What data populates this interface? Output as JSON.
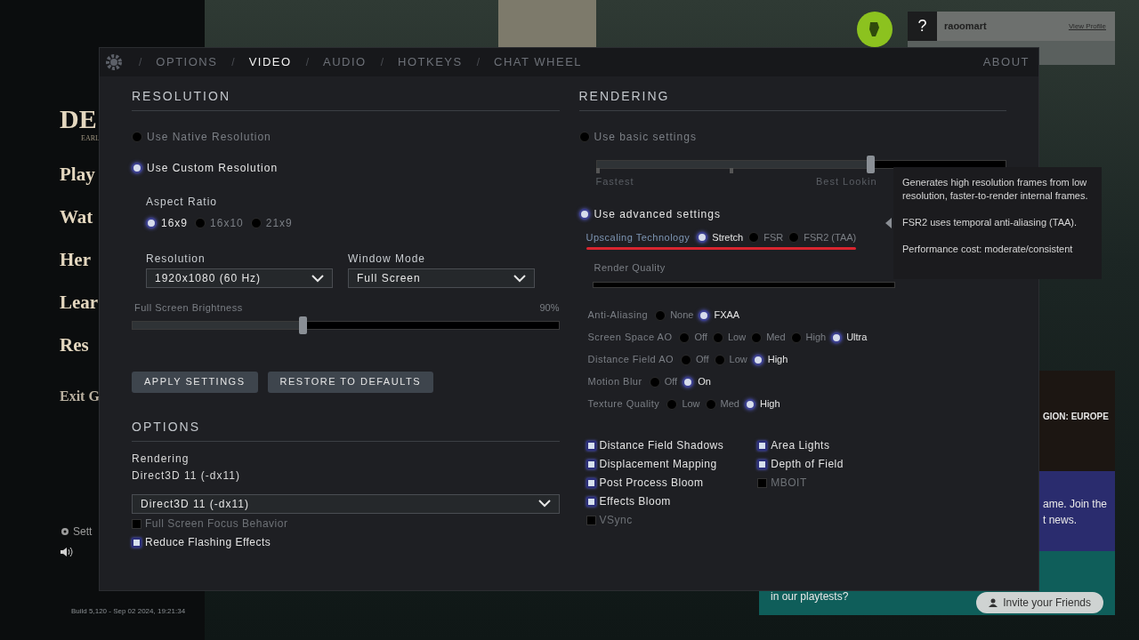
{
  "background": {
    "logo": "DE",
    "logo_sub": "EARL",
    "menu": [
      "Play",
      "Wat",
      "Her",
      "Lear",
      "Res"
    ],
    "exit": "Exit G",
    "settings": "Sett",
    "build": "Build 5,120 - Sep 02 2024, 19:21:34",
    "profile": {
      "badge": "?",
      "name": "raoomart",
      "link": "View Profile"
    },
    "region": "GION: EUROPE",
    "promo_lines": [
      "ame. Join the",
      "t news."
    ],
    "playtest": "in our playtests?",
    "invite": "Invite your Friends"
  },
  "header": {
    "separator": "/",
    "tabs": [
      {
        "label": "OPTIONS",
        "selected": false
      },
      {
        "label": "VIDEO",
        "selected": true
      },
      {
        "label": "AUDIO",
        "selected": false
      },
      {
        "label": "HOTKEYS",
        "selected": false
      },
      {
        "label": "CHAT WHEEL",
        "selected": false
      }
    ],
    "about": "ABOUT"
  },
  "resolution": {
    "title": "RESOLUTION",
    "modes": [
      {
        "label": "Use Native Resolution",
        "selected": false
      },
      {
        "label": "Use Custom Resolution",
        "selected": true
      }
    ],
    "aspect_label": "Aspect Ratio",
    "aspects": [
      {
        "label": "16x9",
        "selected": true
      },
      {
        "label": "16x10",
        "selected": false
      },
      {
        "label": "21x9",
        "selected": false
      }
    ],
    "resolution_label": "Resolution",
    "resolution_value": "1920x1080 (60 Hz)",
    "window_label": "Window Mode",
    "window_value": "Full Screen",
    "brightness_label": "Full Screen Brightness",
    "brightness_reading": "90%",
    "brightness": {
      "level": 0.4
    }
  },
  "buttons": [
    "APPLY SETTINGS",
    "RESTORE TO DEFAULTS"
  ],
  "options": {
    "title": "OPTIONS",
    "rendering_label": "Rendering",
    "rendering_value": "Direct3D 11 (-dx11)",
    "dropdown_value": "Direct3D 11 (-dx11)",
    "checks": [
      {
        "label": "Full Screen Focus Behavior",
        "checked": false
      },
      {
        "label": "Reduce Flashing Effects",
        "checked": true
      }
    ]
  },
  "rendering": {
    "title": "RENDERING",
    "basic": {
      "label": "Use basic settings",
      "selected": false
    },
    "basic_slider": {
      "level": 0.67
    },
    "fastest": "Fastest",
    "best": "Best Lookin",
    "advanced": {
      "label": "Use advanced settings",
      "selected": true
    },
    "upscaling": {
      "label": "Upscaling Technology",
      "underlined": true,
      "options": [
        {
          "label": "Stretch",
          "selected": true
        },
        {
          "label": "FSR",
          "selected": false
        },
        {
          "label": "FSR2 (TAA)",
          "selected": false
        }
      ]
    },
    "render_quality": "Render Quality",
    "groups": [
      {
        "label": "Anti-Aliasing",
        "options": [
          {
            "label": "None",
            "selected": false
          },
          {
            "label": "FXAA",
            "selected": true
          }
        ]
      },
      {
        "label": "Screen Space AO",
        "options": [
          {
            "label": "Off",
            "selected": false
          },
          {
            "label": "Low",
            "selected": false
          },
          {
            "label": "Med",
            "selected": false
          },
          {
            "label": "High",
            "selected": false
          },
          {
            "label": "Ultra",
            "selected": true
          }
        ]
      },
      {
        "label": "Distance Field AO",
        "options": [
          {
            "label": "Off",
            "selected": false
          },
          {
            "label": "Low",
            "selected": false
          },
          {
            "label": "High",
            "selected": true
          }
        ]
      },
      {
        "label": "Motion Blur",
        "options": [
          {
            "label": "Off",
            "selected": false
          },
          {
            "label": "On",
            "selected": true
          }
        ]
      },
      {
        "label": "Texture Quality",
        "options": [
          {
            "label": "Low",
            "selected": false
          },
          {
            "label": "Med",
            "selected": false
          },
          {
            "label": "High",
            "selected": true
          }
        ]
      }
    ],
    "checks_left": [
      {
        "label": "Distance Field Shadows",
        "checked": true
      },
      {
        "label": "Displacement Mapping",
        "checked": true
      },
      {
        "label": "Post Process Bloom",
        "checked": true
      },
      {
        "label": "Effects Bloom",
        "checked": true
      },
      {
        "label": "VSync",
        "checked": false
      }
    ],
    "checks_right": [
      {
        "label": "Area Lights",
        "checked": true
      },
      {
        "label": "Depth of Field",
        "checked": true
      },
      {
        "label": "MBOIT",
        "checked": false
      }
    ]
  },
  "tooltip": [
    "Generates high resolution frames from low resolution, faster-to-render internal frames.",
    "FSR2 uses temporal anti-aliasing (TAA).",
    "Performance cost: moderate/consistent"
  ]
}
